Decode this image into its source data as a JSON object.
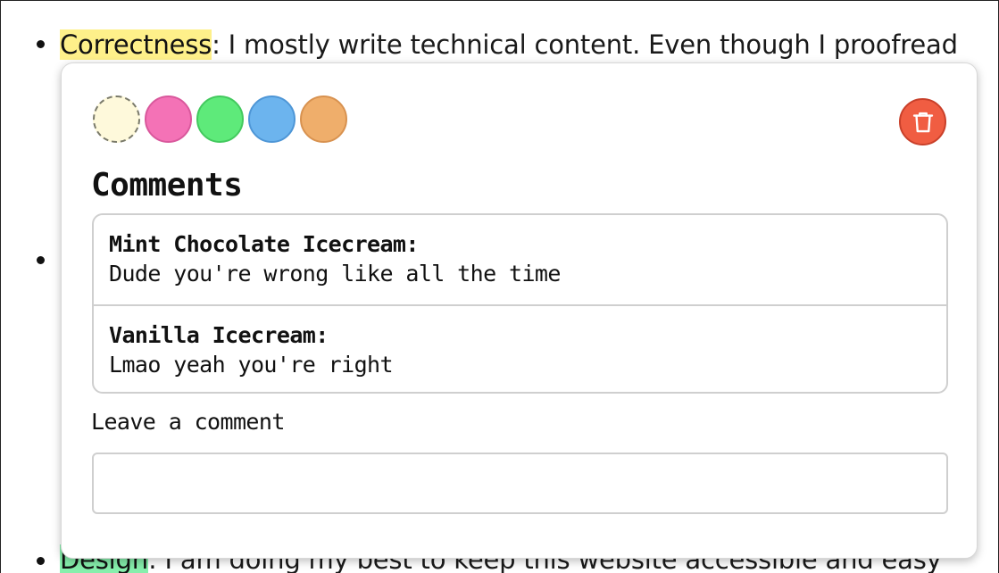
{
  "article": {
    "line1_term": "Correctness",
    "line1_rest": ": I mostly write technical content. Even though I proofread",
    "line3_term": "Design",
    "line3_rest": ": I am doing my best to keep this website accessible and easy"
  },
  "popover": {
    "swatches": [
      {
        "name": "yellow",
        "color": "#fef9db",
        "selected": true
      },
      {
        "name": "pink",
        "color": "#f472b6"
      },
      {
        "name": "green",
        "color": "#5eea7a"
      },
      {
        "name": "blue",
        "color": "#6cb4ee"
      },
      {
        "name": "orange",
        "color": "#efae6b"
      }
    ],
    "delete_color": "#f05d42",
    "heading": "Comments",
    "comments": [
      {
        "author": "Mint Chocolate Icecream:",
        "text": "Dude you're wrong like all the time"
      },
      {
        "author": "Vanilla Icecream:",
        "text": "Lmao yeah you're right"
      }
    ],
    "leave_label": "Leave a comment",
    "input_value": ""
  }
}
